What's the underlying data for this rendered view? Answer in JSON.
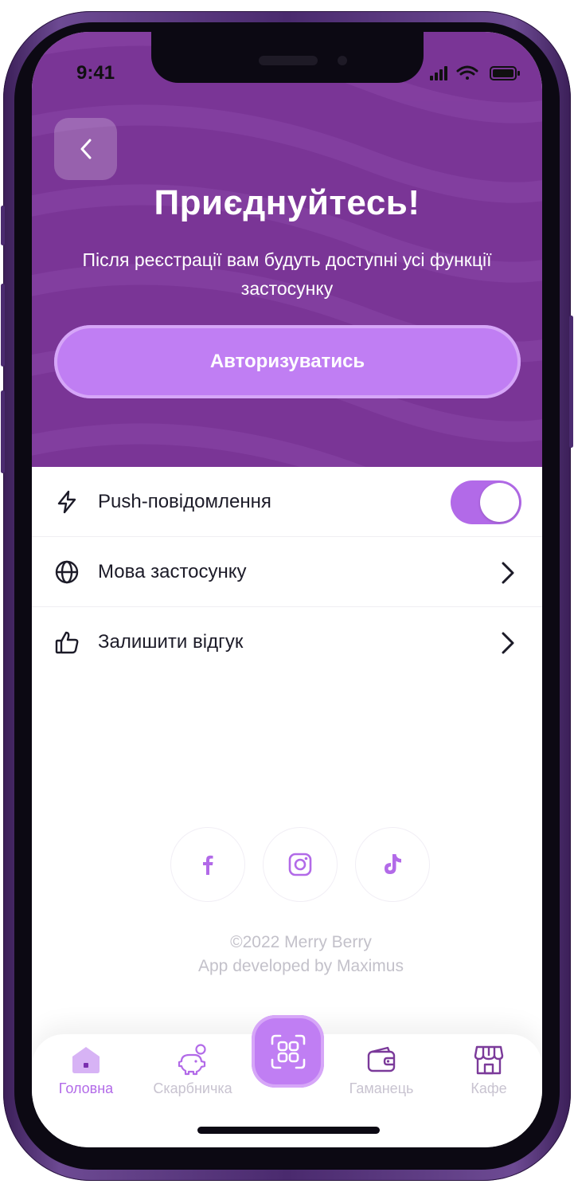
{
  "status_bar": {
    "time": "9:41"
  },
  "header": {
    "title": "Приєднуйтесь!",
    "subtitle": "Після реєстрації вам будуть доступні усі функції застосунку",
    "auth_button": "Авторизуватись"
  },
  "settings": [
    {
      "label": "Push-повідомлення",
      "icon": "lightning-icon",
      "control": "toggle",
      "enabled": true
    },
    {
      "label": "Мова застосунку",
      "icon": "globe-icon",
      "control": "chevron"
    },
    {
      "label": "Залишити відгук",
      "icon": "thumbs-up-icon",
      "control": "chevron"
    }
  ],
  "socials": [
    "facebook-icon",
    "instagram-icon",
    "tiktok-icon"
  ],
  "footer": {
    "copyright": "©2022 Merry Berry",
    "developer": "App developed by Maximus"
  },
  "tabs": [
    {
      "label": "Головна",
      "icon": "home-icon",
      "active": true
    },
    {
      "label": "Скарбничка",
      "icon": "piggy-bank-icon",
      "active": false
    },
    {
      "label": "Гаманець",
      "icon": "wallet-icon",
      "active": false
    },
    {
      "label": "Кафе",
      "icon": "store-icon",
      "active": false
    }
  ],
  "colors": {
    "header_bg": "#7a3596",
    "accent": "#c07ef3",
    "accent_dark": "#b26ae8",
    "tab_active": "#b26ae8",
    "tab_inactive": "#c8c3d0",
    "text_primary": "#1c1b28"
  }
}
